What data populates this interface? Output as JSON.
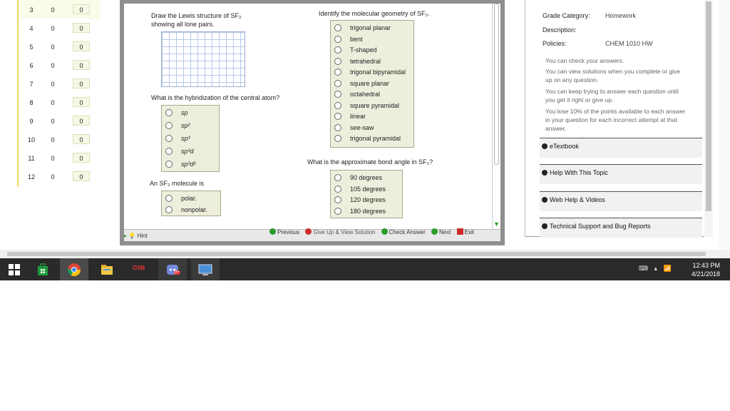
{
  "score_table": {
    "rows": [
      {
        "n": "3",
        "a": "0",
        "b": "0"
      },
      {
        "n": "4",
        "a": "0",
        "b": "0"
      },
      {
        "n": "5",
        "a": "0",
        "b": "0"
      },
      {
        "n": "6",
        "a": "0",
        "b": "0"
      },
      {
        "n": "7",
        "a": "0",
        "b": "0"
      },
      {
        "n": "8",
        "a": "0",
        "b": "0"
      },
      {
        "n": "9",
        "a": "0",
        "b": "0"
      },
      {
        "n": "10",
        "a": "0",
        "b": "0"
      },
      {
        "n": "11",
        "a": "0",
        "b": "0"
      },
      {
        "n": "12",
        "a": "0",
        "b": "0"
      }
    ]
  },
  "question": {
    "lewis_prompt_1": "Draw the Lewis structure of SF₂",
    "lewis_prompt_2": "showing all lone pairs.",
    "hybrid_prompt": "What is the hybridization of the central atom?",
    "hybrid_options": [
      "sp",
      "sp²",
      "sp³",
      "sp³d",
      "sp³d²"
    ],
    "polarity_prompt": "An SF₂ molecule is",
    "polarity_options": [
      "polar.",
      "nonpolar."
    ],
    "geometry_prompt": "Identify the molecular geometry of SF₂.",
    "geometry_options": [
      "trigonal planar",
      "bent",
      "T-shaped",
      "tetrahedral",
      "trigonal bipyramidal",
      "square planar",
      "octahedral",
      "square pyramidal",
      "linear",
      "see-saw",
      "trigonal pyramidal"
    ],
    "angle_prompt": "What is the approximate bond angle in SF₂?",
    "angle_options": [
      "90 degrees",
      "105 degrees",
      "120 degrees",
      "180 degrees"
    ]
  },
  "nav": {
    "previous": "Previous",
    "give_up": "Give Up & View Solution",
    "check": "Check Answer",
    "next": "Next",
    "exit": "Exit",
    "hint": "Hint"
  },
  "right_panel": {
    "grade_category_label": "Grade Category:",
    "grade_category_value": "Homework",
    "description_label": "Description:",
    "policies_label": "Policies:",
    "policies_value": "CHEM 1010 HW",
    "notes": [
      "You can check your answers.",
      "You can view solutions when you complete or give up on any question.",
      "You can keep trying to answer each question until you get it right or give up.",
      "You lose 10% of the points available to each answer in your question for each incorrect attempt at that answer."
    ],
    "sections": [
      "eTextbook",
      "Help With This Topic",
      "Web Help & Videos",
      "Technical Support and Bug Reports"
    ]
  },
  "taskbar": {
    "time": "12:43 PM",
    "date": "4/21/2018",
    "osb_label": "OSB",
    "discord_badge": "9+"
  },
  "colors": {
    "accent_green": "#2c9b2c",
    "give_up_red": "#cc2a2a",
    "taskbar": "#2a2a2a"
  }
}
